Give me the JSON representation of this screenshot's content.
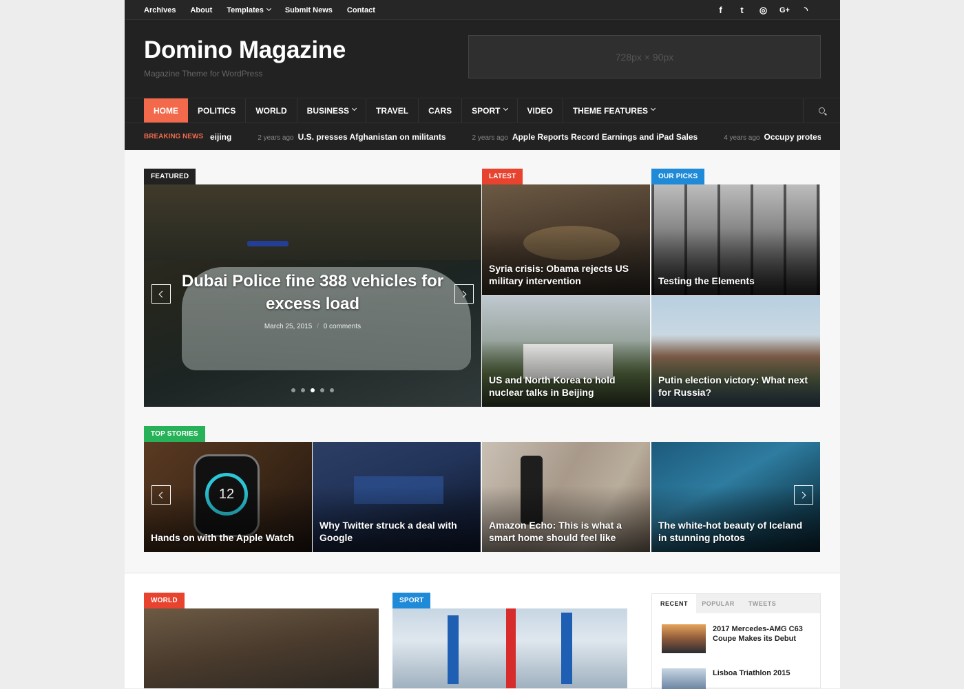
{
  "topbar": {
    "menu": [
      {
        "label": "Archives"
      },
      {
        "label": "About"
      },
      {
        "label": "Templates",
        "has_dropdown": true
      },
      {
        "label": "Submit News"
      },
      {
        "label": "Contact"
      }
    ],
    "social": [
      {
        "icon": "facebook-icon",
        "glyph": "f"
      },
      {
        "icon": "twitter-icon",
        "glyph": "t"
      },
      {
        "icon": "instagram-icon",
        "glyph": "◎"
      },
      {
        "icon": "google-plus-icon",
        "glyph": "G+"
      },
      {
        "icon": "rss-icon",
        "glyph": "◝"
      }
    ]
  },
  "header": {
    "logo": "Domino Magazine",
    "tagline": "Magazine Theme for WordPress",
    "ad_placeholder": "728px × 90px"
  },
  "nav": {
    "items": [
      {
        "label": "HOME",
        "active": true
      },
      {
        "label": "POLITICS"
      },
      {
        "label": "WORLD"
      },
      {
        "label": "BUSINESS",
        "has_dropdown": true
      },
      {
        "label": "TRAVEL"
      },
      {
        "label": "CARS"
      },
      {
        "label": "SPORT",
        "has_dropdown": true
      },
      {
        "label": "VIDEO"
      },
      {
        "label": "THEME FEATURES",
        "has_dropdown": true
      }
    ],
    "search_icon": "search-icon",
    "active_color": "#f26a4b"
  },
  "breaking": {
    "label": "BREAKING NEWS",
    "partial": "eijing",
    "items": [
      {
        "ago": "2 years ago",
        "title": "U.S. presses Afghanistan on militants"
      },
      {
        "ago": "2 years ago",
        "title": "Apple Reports Record Earnings and iPad Sales"
      },
      {
        "ago": "4 years ago",
        "title": "Occupy protest: 'Pub"
      }
    ]
  },
  "sections": {
    "featured": {
      "label": "FEATURED",
      "label_color": "#222222",
      "title": "Dubai Police fine 388 vehicles for excess load",
      "date": "March 25, 2015",
      "sep": "/",
      "comments": "0 comments",
      "slide_count": 5,
      "active_slide": 3
    },
    "latest": {
      "label": "LATEST",
      "label_color": "#e8432f",
      "items": [
        {
          "title": "Syria crisis: Obama rejects US military intervention"
        },
        {
          "title": "US and North Korea to hold nuclear talks in Beijing"
        }
      ]
    },
    "our_picks": {
      "label": "OUR PICKS",
      "label_color": "#1e8ad8",
      "items": [
        {
          "title": "Testing the Elements"
        },
        {
          "title": "Putin election victory: What next for Russia?"
        }
      ]
    },
    "top_stories": {
      "label": "TOP STORIES",
      "label_color": "#27b259",
      "items": [
        {
          "title": "Hands on with the Apple Watch"
        },
        {
          "title": "Why Twitter struck a deal with Google"
        },
        {
          "title": "Amazon Echo: This is what a smart home should feel like"
        },
        {
          "title": "The white-hot beauty of Iceland in stunning photos"
        }
      ]
    },
    "world": {
      "label": "WORLD",
      "label_color": "#e8432f"
    },
    "sport": {
      "label": "SPORT",
      "label_color": "#1e8ad8"
    }
  },
  "widget": {
    "tabs": [
      {
        "label": "RECENT",
        "active": true
      },
      {
        "label": "POPULAR"
      },
      {
        "label": "TWEETS"
      }
    ],
    "items": [
      {
        "title": "2017 Mercedes-AMG C63 Coupe Makes its Debut"
      },
      {
        "title": "Lisboa Triathlon 2015"
      }
    ]
  }
}
